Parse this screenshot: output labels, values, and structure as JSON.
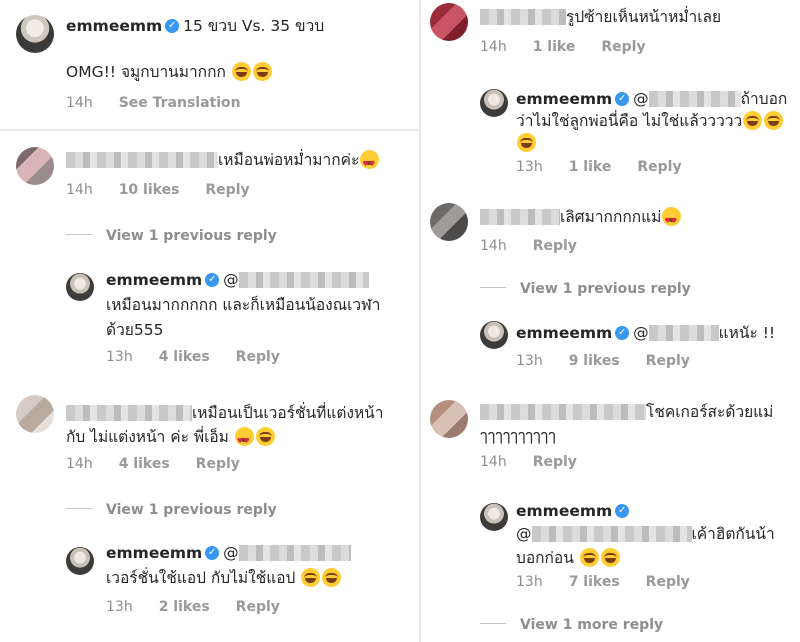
{
  "caption": {
    "username": "emmeemm",
    "title_text": "15 ขวบ Vs. 35 ขวบ",
    "body_text": "OMG!! จมูกบานมากกก",
    "time": "14h",
    "see_translation": "See Translation"
  },
  "left_column": [
    {
      "id": "c1",
      "line1": "เหมือนพ่อหม่ำมากค่ะ",
      "time": "14h",
      "likes": "10 likes",
      "reply": "Reply",
      "view_replies": "View 1 previous reply",
      "reply_item": {
        "username": "emmeemm",
        "line1_prefix": "@",
        "line2": "เหมือนมากกกกก และก็เหมือนน้องณเวฬา",
        "line3": "ด้วย555",
        "time": "13h",
        "likes": "4 likes",
        "reply": "Reply"
      }
    },
    {
      "id": "c2",
      "line1": "เหมือนเป็นเวอร์ชั่นที่แต่งหน้า",
      "line2": "กับ ไม่แต่งหน้า ค่ะ พี่เอ็ม",
      "time": "14h",
      "likes": "4 likes",
      "reply": "Reply",
      "view_replies": "View 1 previous reply",
      "reply_item": {
        "username": "emmeemm",
        "line1_prefix": "@",
        "line2": "เวอร์ชั่นใช้แอป กับไม่ใช้แอป",
        "time": "13h",
        "likes": "2 likes",
        "reply": "Reply"
      }
    }
  ],
  "right_column": [
    {
      "id": "c3",
      "line1": "รูปซ้ายเห็นหน้าหม่ำเลย",
      "time": "14h",
      "likes": "1 like",
      "reply": "Reply",
      "reply_item": {
        "username": "emmeemm",
        "line1_prefix": "@",
        "line1_suffix": "ถ้าบอก",
        "line2": "ว่าไม่ใช่ลูกพ่อนี่คือ ไม่ใช่แล้ววววว",
        "time": "13h",
        "likes": "1 like",
        "reply": "Reply"
      }
    },
    {
      "id": "c4",
      "line1": "เลิศมากกกกแม่",
      "time": "14h",
      "reply": "Reply",
      "view_replies": "View 1 previous reply",
      "reply_item": {
        "username": "emmeemm",
        "line1_prefix": "@",
        "line1_suffix": "แหนัะ !!",
        "time": "13h",
        "likes": "9 likes",
        "reply": "Reply"
      }
    },
    {
      "id": "c5",
      "line1": "โชคเกอร์สะด้วยแม่",
      "line2": "ๅๅๅๅๅๅๅๅๅๅ",
      "time": "14h",
      "reply": "Reply",
      "reply_item": {
        "username": "emmeemm",
        "line2_prefix": "@",
        "line2_suffix": "เค้าฮิตกันน้า",
        "line3": "บอกก่อน",
        "time": "13h",
        "likes": "7 likes",
        "reply": "Reply"
      },
      "view_more": "View 1 more reply"
    }
  ],
  "colors": {
    "text": "#262626",
    "meta": "#8e8e8e",
    "verified_badge": "#3897f0",
    "divider": "#e9e9e9"
  },
  "icons": [
    "verified-badge-icon",
    "laughing-emoji-icon",
    "heart-eyes-emoji-icon",
    "avatar"
  ]
}
